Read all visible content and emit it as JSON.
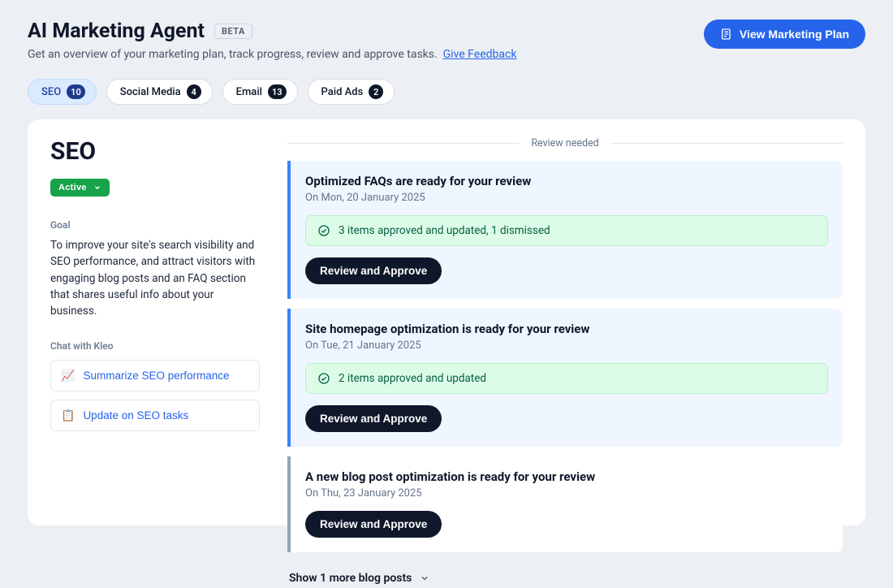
{
  "header": {
    "title": "AI Marketing Agent",
    "beta": "BETA",
    "subtitle": "Get an overview of your marketing plan, track progress, review and approve tasks.",
    "feedback": "Give Feedback",
    "cta": "View Marketing Plan"
  },
  "tabs": [
    {
      "label": "SEO",
      "count": "10"
    },
    {
      "label": "Social Media",
      "count": "4"
    },
    {
      "label": "Email",
      "count": "13"
    },
    {
      "label": "Paid Ads",
      "count": "2"
    }
  ],
  "sidebar": {
    "section_title": "SEO",
    "status": "Active",
    "goal_label": "Goal",
    "goal_text": "To improve your site's search visibility and SEO performance, and attract visitors with engaging blog posts and an FAQ section that shares useful info about your business.",
    "chat_label": "Chat with Kleo",
    "chat_items": [
      {
        "emoji": "📈",
        "label": "Summarize SEO performance"
      },
      {
        "emoji": "📋",
        "label": "Update on SEO tasks"
      }
    ]
  },
  "review": {
    "header": "Review needed",
    "button": "Review and Approve",
    "show_more": "Show 1 more blog posts",
    "tasks": [
      {
        "title": "Optimized FAQs are ready for your review",
        "date": "On Mon, 20 January 2025",
        "approved": "3 items approved and updated, 1 dismissed",
        "has_approved": true
      },
      {
        "title": "Site homepage optimization is ready for your review",
        "date": "On Tue, 21 January 2025",
        "approved": "2 items approved and updated",
        "has_approved": true
      },
      {
        "title": "A new blog post optimization is ready for your review",
        "date": "On Thu, 23 January 2025",
        "has_approved": false
      }
    ]
  }
}
